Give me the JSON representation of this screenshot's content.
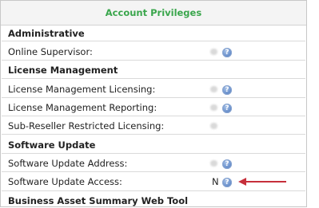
{
  "panel": {
    "title": "Account Privileges"
  },
  "sections": {
    "administrative": "Administrative",
    "license_management": "License Management",
    "software_update": "Software Update",
    "business_asset": "Business Asset Summary Web Tool"
  },
  "rows": {
    "online_supervisor": {
      "label": "Online Supervisor:"
    },
    "license_management_licensing": {
      "label": "License Management Licensing:"
    },
    "license_management_reporting": {
      "label": "License Management Reporting:"
    },
    "sub_reseller_restricted_licensing": {
      "label": "Sub-Reseller Restricted Licensing:"
    },
    "software_update_address": {
      "label": "Software Update Address:"
    },
    "software_update_access": {
      "label": "Software Update Access:",
      "value": "N"
    }
  },
  "help_glyph": "?",
  "colors": {
    "title": "#3aa64c",
    "annotation_arrow": "#c62f3b",
    "help_icon": "#5b83c4"
  },
  "icons": {
    "help": "question-mark-help-icon",
    "annotation": "red-arrow-annotation"
  }
}
